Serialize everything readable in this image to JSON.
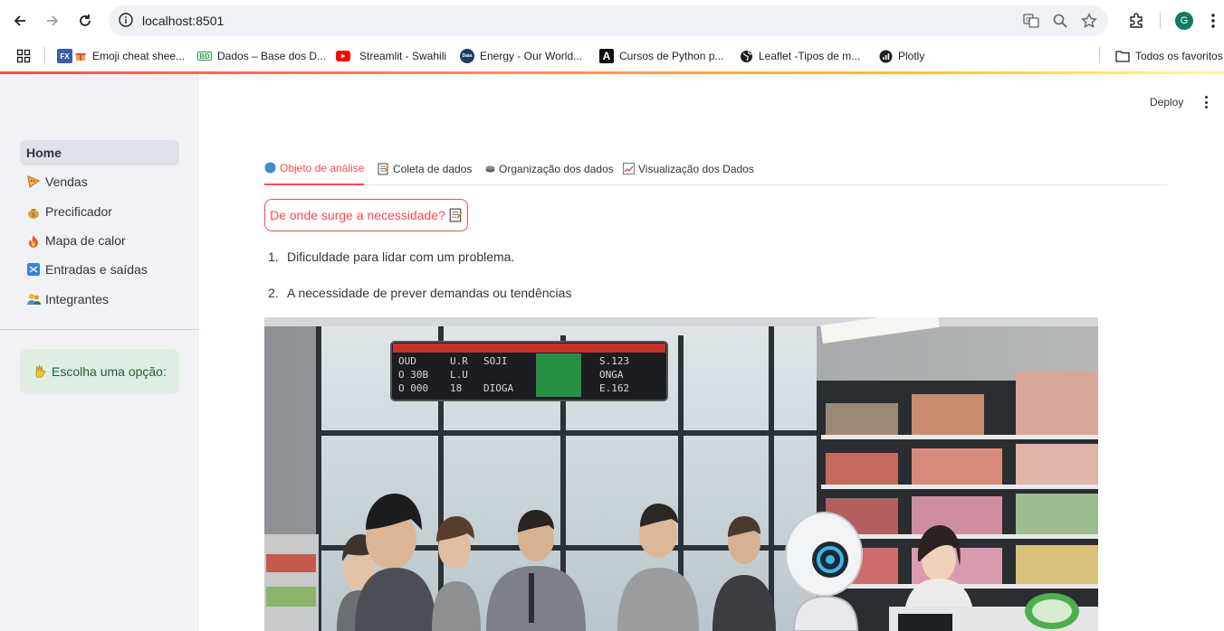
{
  "browser": {
    "url": "localhost:8501",
    "profile_initial": "G",
    "bookmarks": [
      {
        "label": "Emoji cheat shee...",
        "icon": "fx-gift-icon"
      },
      {
        "label": "Dados – Base dos D...",
        "icon": "bd-icon"
      },
      {
        "label": "Streamlit - Swahili",
        "icon": "youtube-icon"
      },
      {
        "label": "Energy - Our World...",
        "icon": "owid-icon"
      },
      {
        "label": "Cursos de Python p...",
        "icon": "a-icon"
      },
      {
        "label": "Leaflet -Tipos de m...",
        "icon": "globe-icon"
      },
      {
        "label": "Plotly",
        "icon": "plotly-icon"
      }
    ],
    "all_bookmarks_label": "Todos os favoritos"
  },
  "header": {
    "deploy_label": "Deploy"
  },
  "sidebar": {
    "items": [
      {
        "label": "Home",
        "icon": "",
        "active": true
      },
      {
        "label": "Vendas",
        "icon": "pizza-icon"
      },
      {
        "label": "Precificador",
        "icon": "money-bag-icon"
      },
      {
        "label": "Mapa de calor",
        "icon": "fire-icon"
      },
      {
        "label": "Entradas e saídas",
        "icon": "shuffle-icon"
      },
      {
        "label": "Integrantes",
        "icon": "people-icon"
      }
    ],
    "info_text": "Escolha uma opção:",
    "info_icon": "waving-hand-icon"
  },
  "main": {
    "tabs": [
      {
        "label": "Objeto de análise",
        "icon": "globe-icon",
        "active": true
      },
      {
        "label": "Coleta de dados",
        "icon": "memo-icon"
      },
      {
        "label": "Organização dos dados",
        "icon": "stack-icon"
      },
      {
        "label": "Visualização dos Dados",
        "icon": "chart-icon"
      }
    ],
    "need_button_label": "De onde surge a necessidade?",
    "list": [
      {
        "number": "1.",
        "text": "Dificuldade para lidar com um problema."
      },
      {
        "number": "2.",
        "text": "A necessidade de prever demandas ou tendências"
      }
    ]
  },
  "colors": {
    "accent": "#ff4b4b",
    "sidebar_bg": "#f0f2f6",
    "info_bg": "#dfede3",
    "info_text": "#1b6333"
  }
}
